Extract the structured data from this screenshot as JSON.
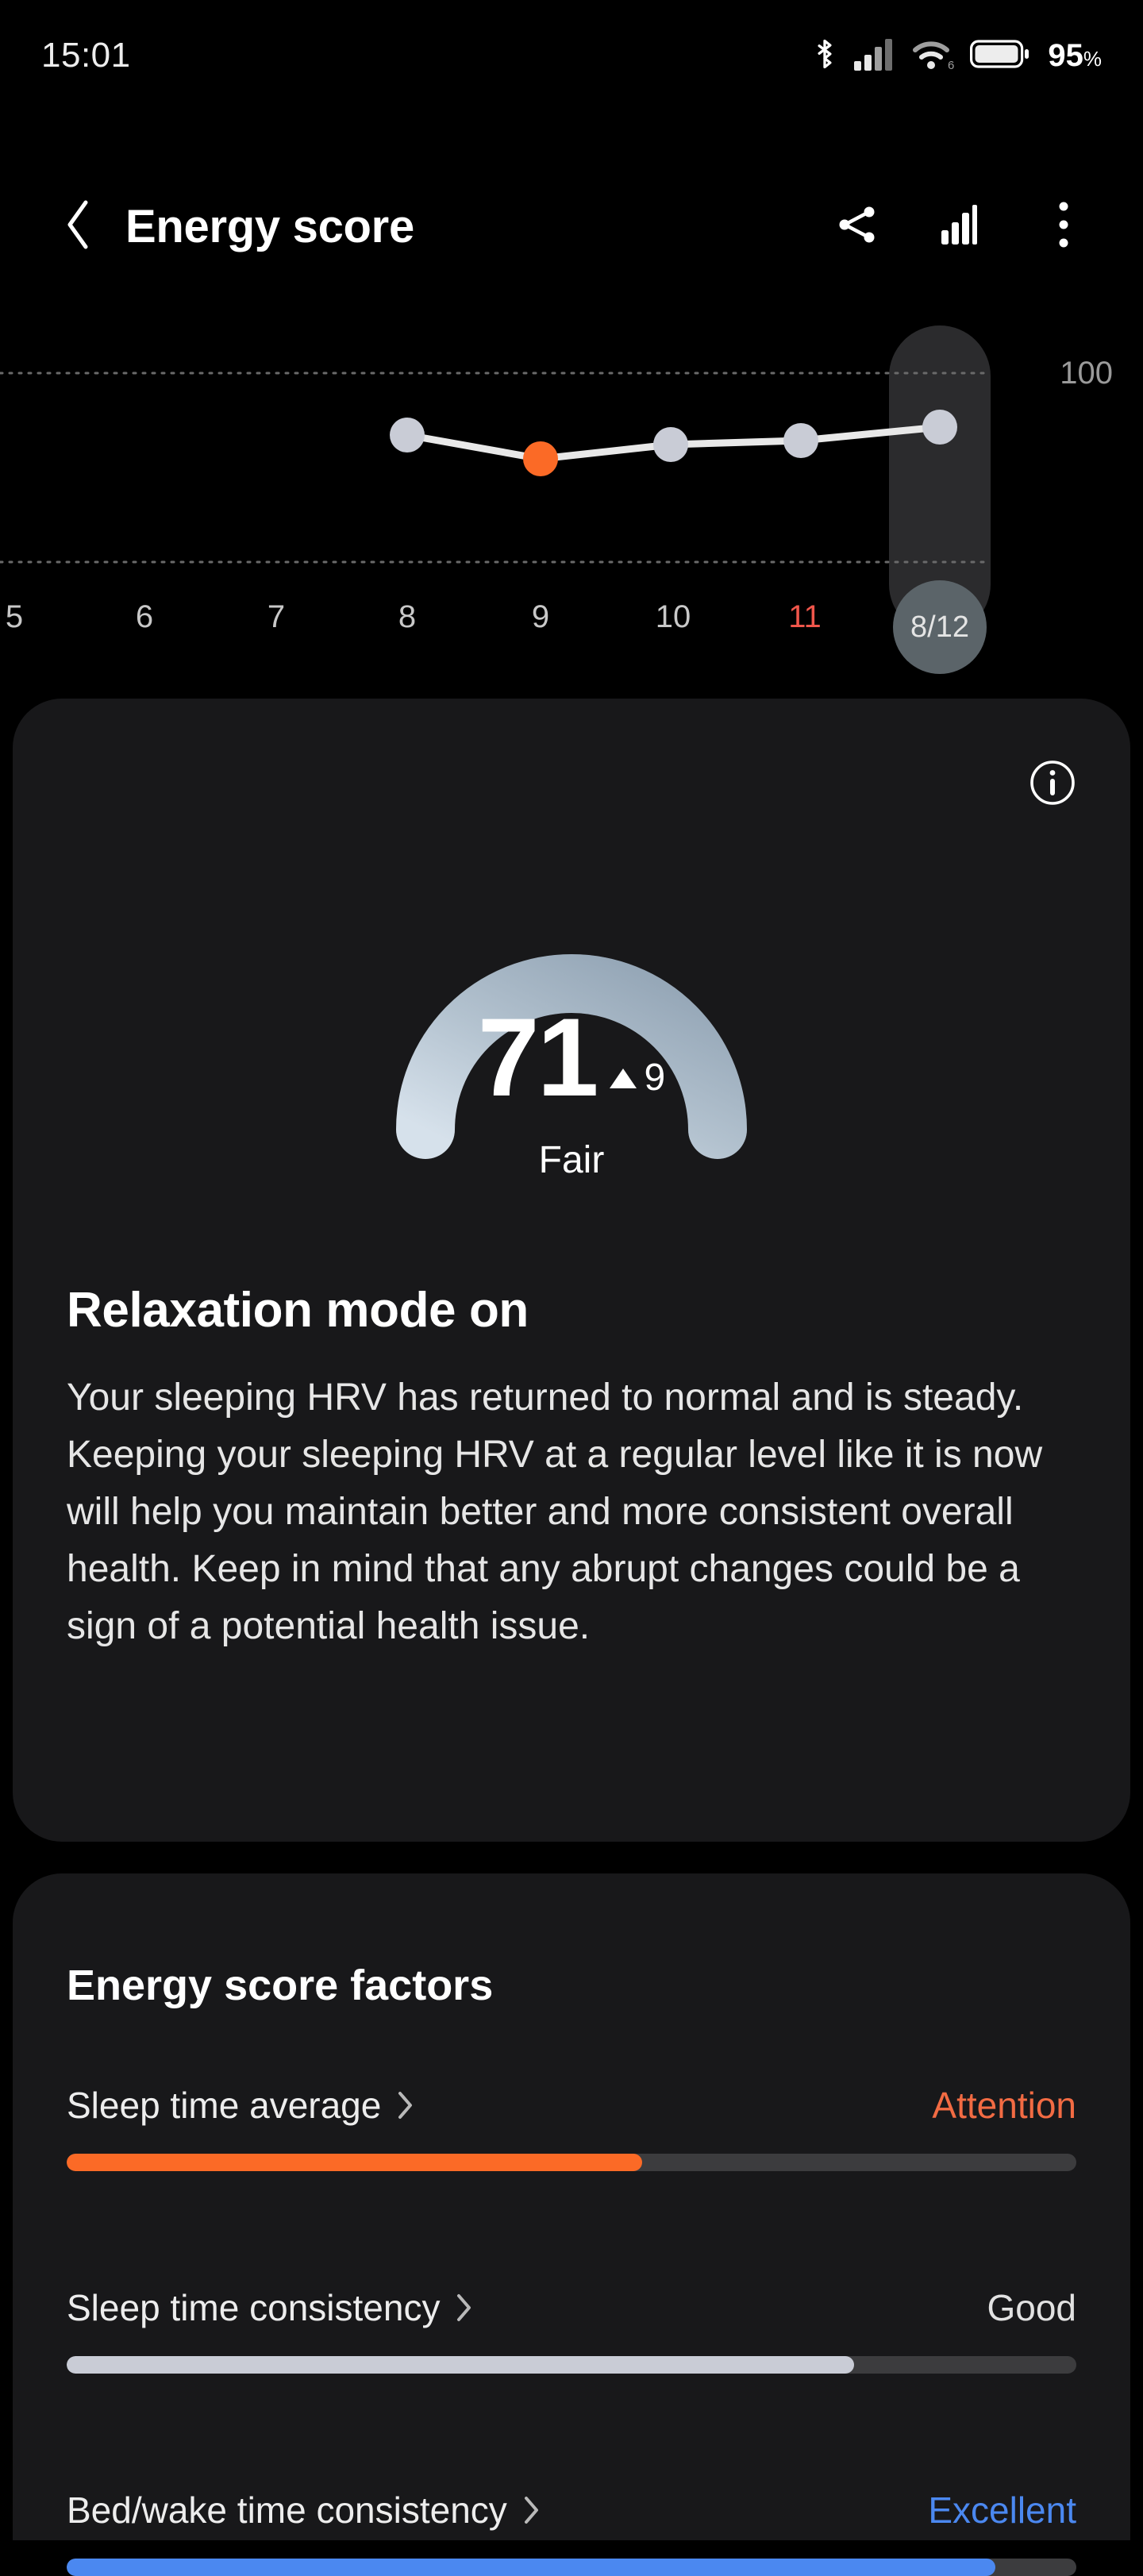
{
  "status_bar": {
    "time": "15:01",
    "battery_percent": "95",
    "battery_unit": "%",
    "icons": [
      "bluetooth-icon",
      "cellular-signal-icon",
      "wifi-icon",
      "battery-icon"
    ]
  },
  "app_bar": {
    "back_icon": "chevron-left-icon",
    "title": "Energy score",
    "actions": [
      {
        "name": "share-icon",
        "label": "Share"
      },
      {
        "name": "chart-icon",
        "label": "Trends"
      },
      {
        "name": "more-options-icon",
        "label": "More options"
      }
    ]
  },
  "chart_data": {
    "type": "line",
    "title": "Energy score trend",
    "categories": [
      "5",
      "6",
      "7",
      "8",
      "9",
      "10",
      "11",
      "8/12"
    ],
    "x": [
      "8",
      "9",
      "10",
      "11",
      "8/12"
    ],
    "values": [
      73,
      62,
      69,
      70,
      71
    ],
    "point_colors": [
      "#C9CCD6",
      "#FB6A26",
      "#C9CCD6",
      "#C9CCD6",
      "#C9CCD6"
    ],
    "ylim": [
      0,
      100
    ],
    "ymax_label": "100",
    "grid": true,
    "xlabel": "",
    "ylabel": "",
    "weekend_ticks": [
      "11"
    ],
    "selected_category": "8/12",
    "selected_label": "8/12",
    "line_color": "#E8E8E8"
  },
  "score_card": {
    "info_icon": "info-icon",
    "score": "71",
    "delta_icon": "triangle-up-icon",
    "delta": "9",
    "grade": "Fair",
    "gauge": {
      "percent": 71,
      "track_color": "#3E3E40",
      "gradient_start": "#D4DFE9",
      "gradient_end": "#93A5B5"
    },
    "insight_title": "Relaxation mode on",
    "insight_body": "Your sleeping HRV has returned to normal and is steady. Keeping your sleeping HRV at a regular level like it is now will help you maintain better and more consistent overall health. Keep in mind that any abrupt changes could be a sign of a potential health issue."
  },
  "factors_card": {
    "title": "Energy score factors",
    "rows": [
      {
        "name": "Sleep time average",
        "chevron": "chevron-right-icon",
        "status": "Attention",
        "status_color": "#F26B43",
        "bar_percent": 57,
        "bar_color": "#FB6A26"
      },
      {
        "name": "Sleep time consistency",
        "chevron": "chevron-right-icon",
        "status": "Good",
        "status_color": "#E2E2E2",
        "bar_percent": 78,
        "bar_color": "#C9CCD6"
      },
      {
        "name": "Bed/wake time consistency",
        "chevron": "chevron-right-icon",
        "status": "Excellent",
        "status_color": "#4B88F0",
        "bar_percent": 92,
        "bar_color": "#4B88F0"
      }
    ]
  }
}
